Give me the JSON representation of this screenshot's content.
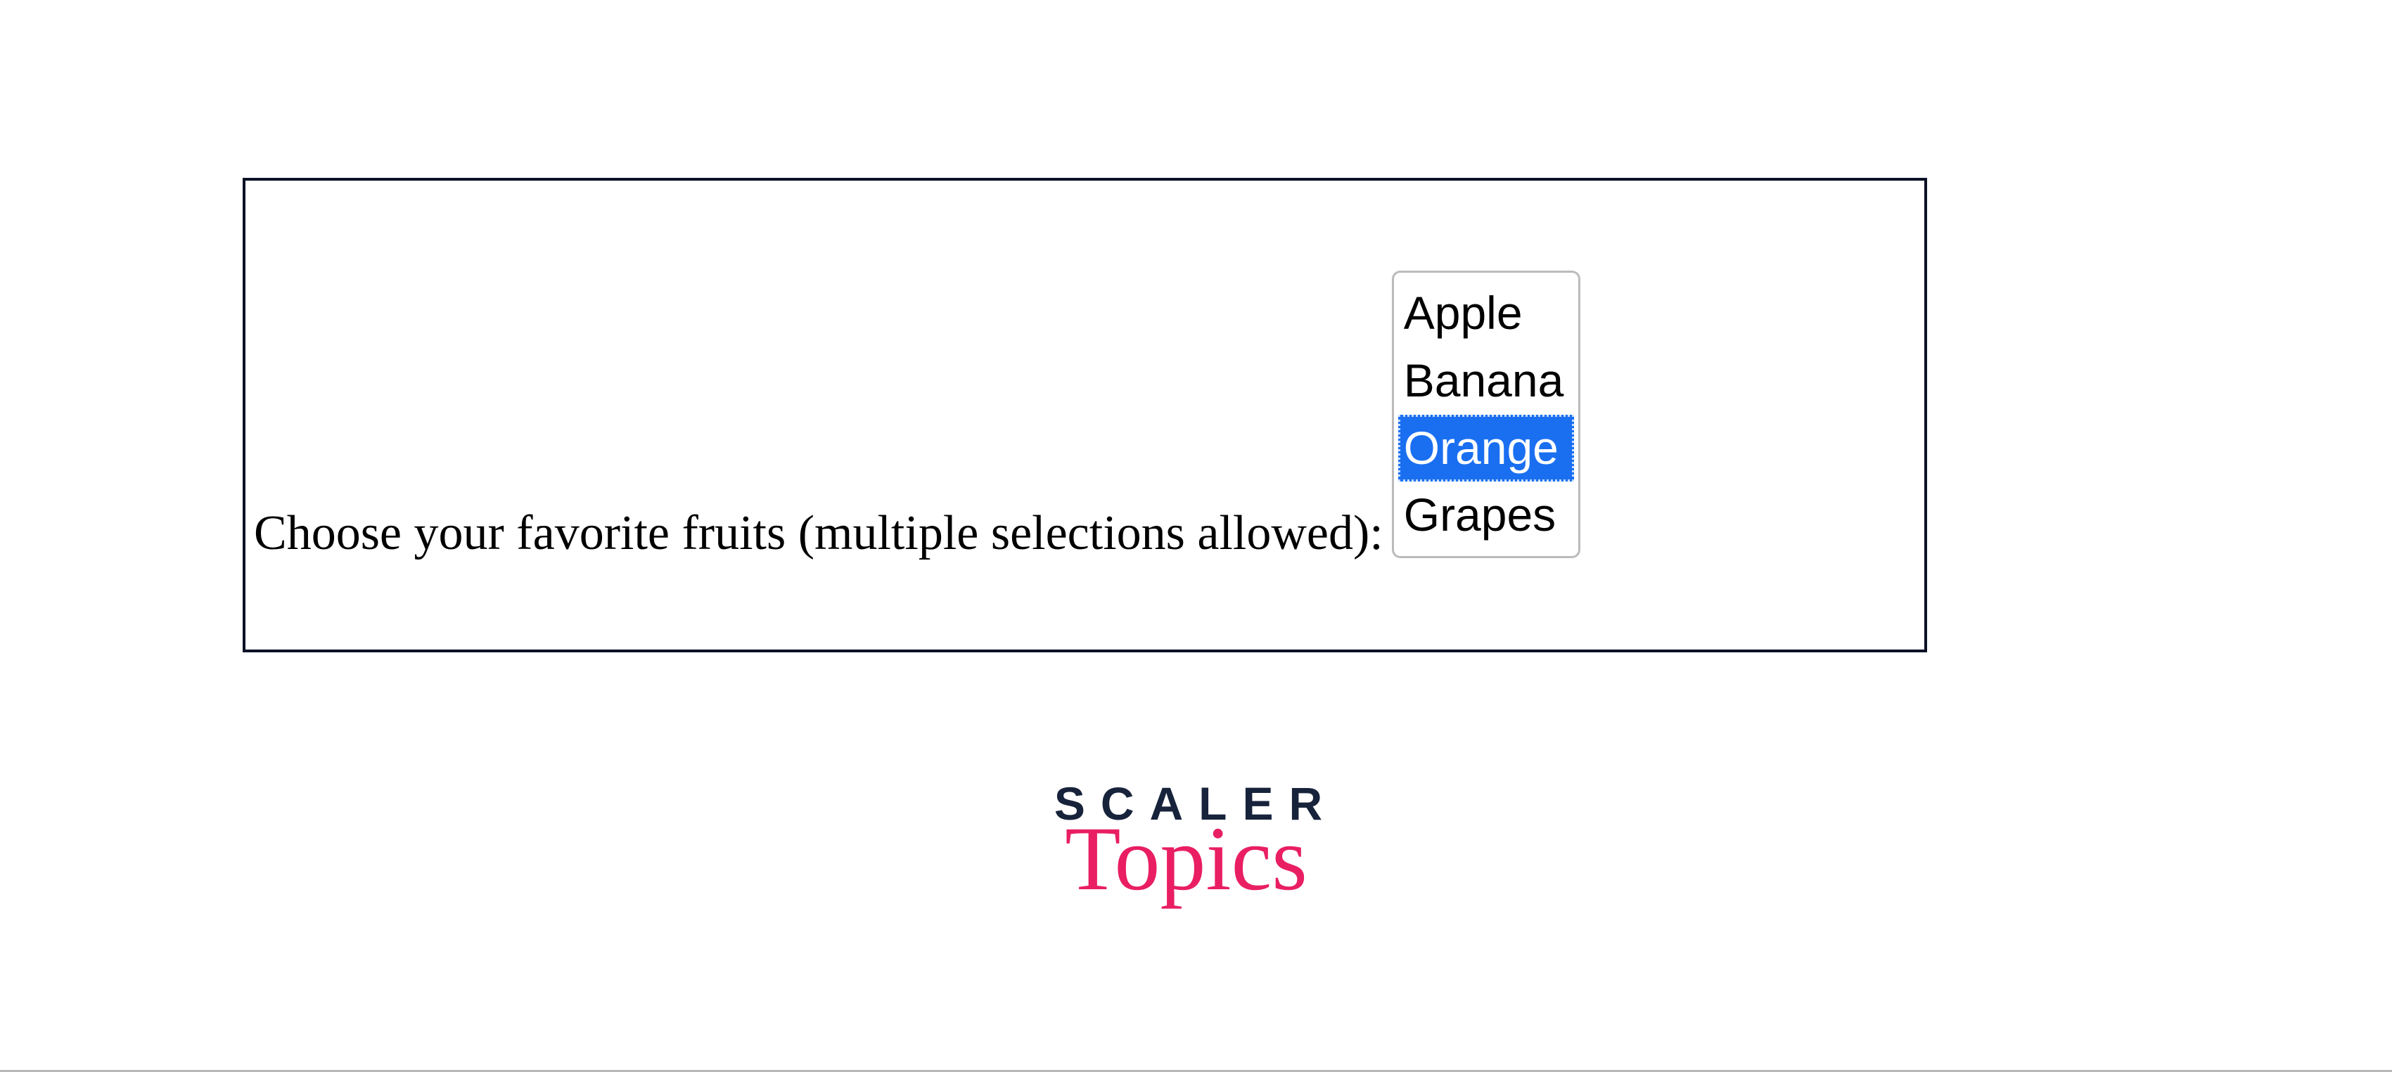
{
  "form": {
    "label": "Choose your favorite fruits (multiple selections allowed):",
    "options": [
      {
        "label": "Apple",
        "selected": false
      },
      {
        "label": "Banana",
        "selected": false
      },
      {
        "label": "Orange",
        "selected": true
      },
      {
        "label": "Grapes",
        "selected": false
      }
    ]
  },
  "logo": {
    "top": "SCALER",
    "bottom": "Topics"
  }
}
